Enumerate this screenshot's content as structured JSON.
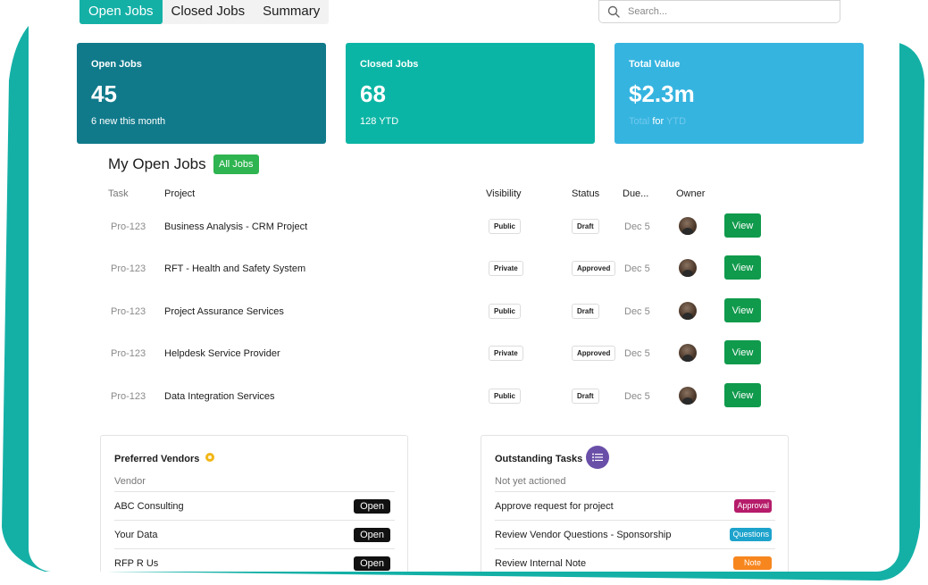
{
  "tabs": [
    {
      "label": "Open Jobs",
      "active": true
    },
    {
      "label": "Closed Jobs",
      "active": false
    },
    {
      "label": "Summary",
      "active": false
    }
  ],
  "search": {
    "placeholder": "Search...",
    "icon": "search-icon"
  },
  "stats": {
    "open": {
      "title": "Open Jobs",
      "value": "45",
      "sub": "6 new this month"
    },
    "closed": {
      "title": "Closed Jobs",
      "value": "68",
      "sub": "128 YTD"
    },
    "total": {
      "title": "Total Value",
      "value": "$2.3m",
      "sub_a": "Total",
      "sub_b": "for",
      "sub_c": "YTD"
    }
  },
  "my_jobs": {
    "title": "My Open Jobs",
    "all_jobs_label": "All Jobs",
    "headers": {
      "task": "Task",
      "project": "Project",
      "visibility": "Visibility",
      "status": "Status",
      "due": "Due...",
      "owner": "Owner"
    },
    "rows": [
      {
        "task": "Pro-123",
        "project": "Business Analysis - CRM Project",
        "visibility": "Public",
        "status": "Draft",
        "due": "Dec 5",
        "action": "View"
      },
      {
        "task": "Pro-123",
        "project": "RFT - Health and Safety System",
        "visibility": "Private",
        "status": "Approved",
        "due": "Dec 5",
        "action": "View"
      },
      {
        "task": "Pro-123",
        "project": "Project Assurance Services",
        "visibility": "Public",
        "status": "Draft",
        "due": "Dec 5",
        "action": "View"
      },
      {
        "task": "Pro-123",
        "project": "Helpdesk Service Provider",
        "visibility": "Private",
        "status": "Approved",
        "due": "Dec 5",
        "action": "View"
      },
      {
        "task": "Pro-123",
        "project": "Data Integration Services",
        "visibility": "Public",
        "status": "Draft",
        "due": "Dec 5",
        "action": "View"
      }
    ]
  },
  "vendors": {
    "title": "Preferred Vendors",
    "column": "Vendor",
    "items": [
      {
        "name": "ABC Consulting",
        "action": "Open"
      },
      {
        "name": "Your Data",
        "action": "Open"
      },
      {
        "name": "RFP R Us",
        "action": "Open"
      }
    ]
  },
  "tasks": {
    "title": "Outstanding Tasks",
    "subtitle": "Not yet actioned",
    "items": [
      {
        "label": "Approve request for project",
        "tag": "Approval"
      },
      {
        "label": "Review Vendor Questions -  Sponsorship",
        "tag": "Questions"
      },
      {
        "label": "Review Internal Note",
        "tag": "Note"
      }
    ]
  },
  "colors": {
    "teal_frame": "#14b0a6",
    "card_open": "#107a8b",
    "card_closed": "#0bb5a5",
    "card_total": "#36b4e0",
    "view_button": "#109a4c",
    "all_jobs": "#2eb450",
    "approval_tag": "#b61c6a",
    "questions_tag": "#1da3cc",
    "note_tag": "#f7861f"
  }
}
